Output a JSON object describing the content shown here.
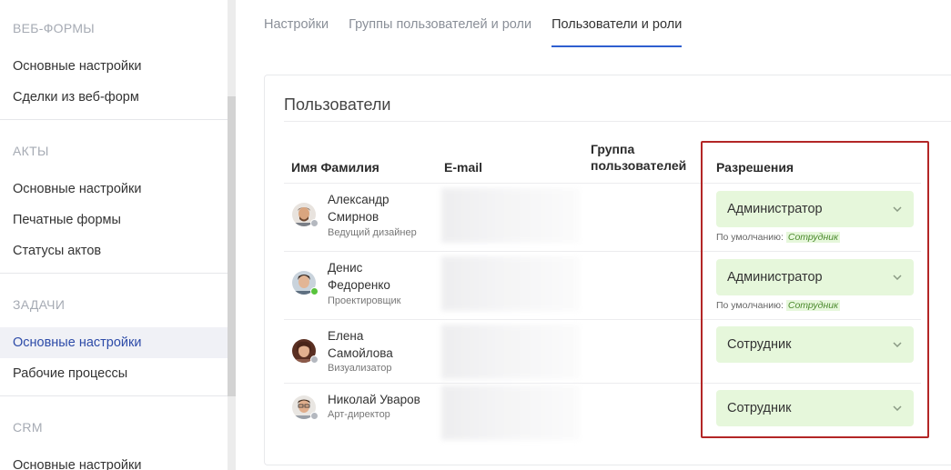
{
  "sidebar": {
    "sections": [
      {
        "title": "ВЕБ-ФОРМЫ",
        "items": [
          {
            "label": "Основные настройки"
          },
          {
            "label": "Сделки из веб-форм"
          }
        ]
      },
      {
        "title": "АКТЫ",
        "items": [
          {
            "label": "Основные настройки"
          },
          {
            "label": "Печатные формы"
          },
          {
            "label": "Статусы актов"
          }
        ]
      },
      {
        "title": "ЗАДАЧИ",
        "items": [
          {
            "label": "Основные настройки",
            "active": true
          },
          {
            "label": "Рабочие процессы"
          }
        ]
      },
      {
        "title": "CRM",
        "items": [
          {
            "label": "Основные настройки"
          }
        ]
      }
    ]
  },
  "tabs": [
    {
      "label": "Настройки"
    },
    {
      "label": "Группы пользователей и роли"
    },
    {
      "label": "Пользователи и роли",
      "active": true
    }
  ],
  "card": {
    "title": "Пользователи",
    "columns": {
      "name": "Имя Фамилия",
      "email": "E-mail",
      "group_line1": "Группа",
      "group_line2": "пользователей",
      "permissions": "Разрешения"
    },
    "default_prefix": "По умолчанию:",
    "users": [
      {
        "name_line1": "Александр",
        "name_line2": "Смирнов",
        "role": "Ведущий дизайнер",
        "status": "offline",
        "permission": "Администратор",
        "default_value": "Сотрудник"
      },
      {
        "name_line1": "Денис",
        "name_line2": "Федоренко",
        "role": "Проектировщик",
        "status": "online",
        "permission": "Администратор",
        "default_value": "Сотрудник"
      },
      {
        "name_line1": "Елена",
        "name_line2": "Самойлова",
        "role": "Визуализатор",
        "status": "offline",
        "permission": "Сотрудник"
      },
      {
        "name_line1": "Николай Уваров",
        "name_line2": "",
        "role": "Арт-директор",
        "status": "offline",
        "permission": "Сотрудник"
      }
    ]
  },
  "colors": {
    "accent": "#2f5fd0",
    "select_bg": "#e6f7db",
    "highlight": "#b32626",
    "online": "#58c33c"
  }
}
